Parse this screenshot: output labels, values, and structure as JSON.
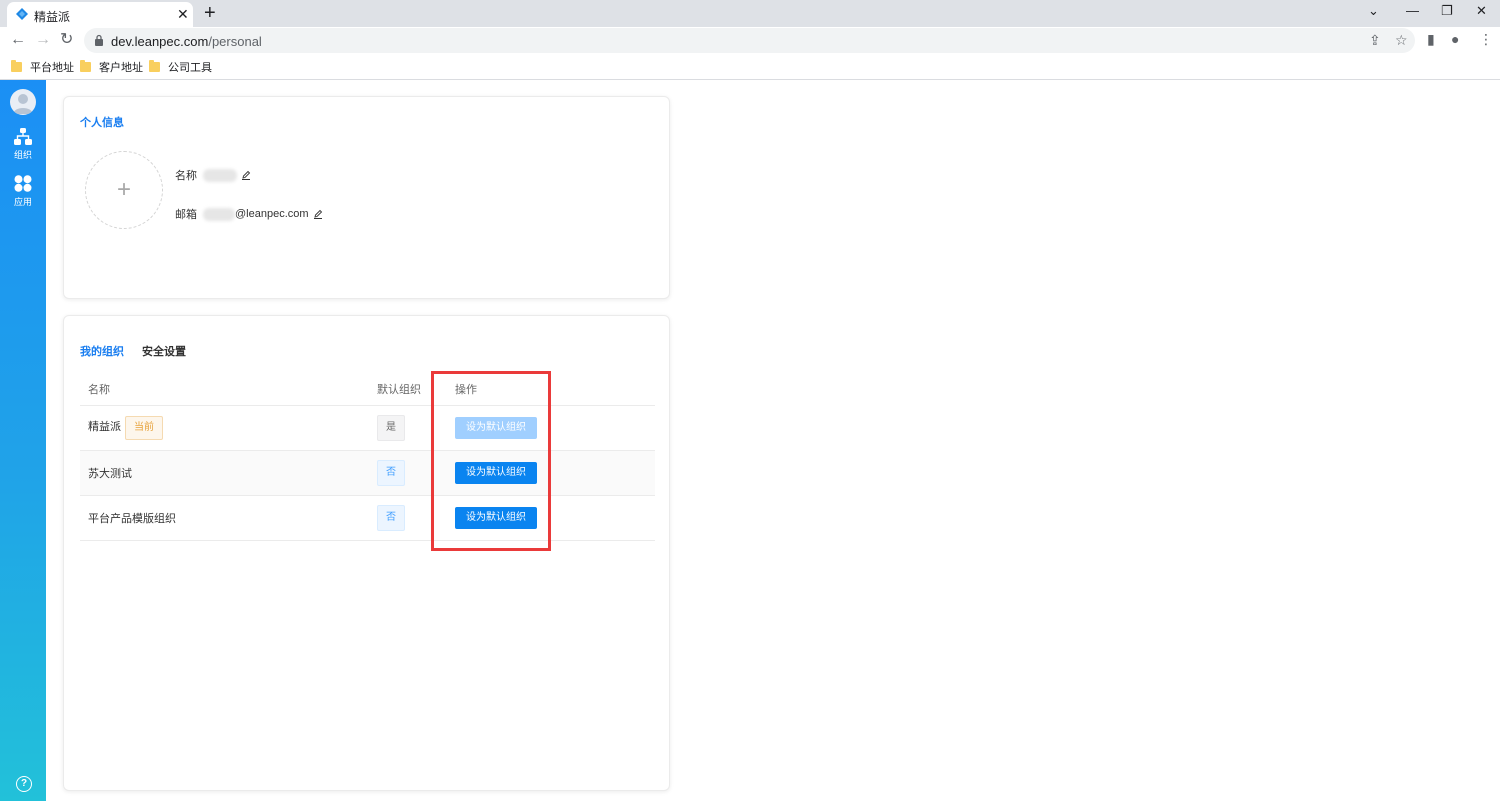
{
  "browser": {
    "tab_title": "精益派",
    "url_host": "dev.leanpec.com",
    "url_path": "/personal",
    "bookmarks": [
      "平台地址",
      "客户地址",
      "公司工具"
    ]
  },
  "sidebar": {
    "items": [
      {
        "label": "组织",
        "icon": "org-tree-icon"
      },
      {
        "label": "应用",
        "icon": "apps-icon"
      }
    ]
  },
  "profile": {
    "title": "个人信息",
    "name_label": "名称",
    "email_label": "邮箱",
    "email_suffix": "@leanpec.com"
  },
  "orgs": {
    "tabs": [
      {
        "label": "我的组织",
        "active": true
      },
      {
        "label": "安全设置",
        "active": false
      }
    ],
    "columns": [
      "名称",
      "默认组织",
      "操作"
    ],
    "rows": [
      {
        "name": "精益派",
        "badge": "当前",
        "default": "是",
        "action": "设为默认组织",
        "action_disabled": true
      },
      {
        "name": "苏大测试",
        "default": "否",
        "action": "设为默认组织",
        "action_disabled": false
      },
      {
        "name": "平台产品模版组织",
        "default": "否",
        "action": "设为默认组织",
        "action_disabled": false
      }
    ]
  },
  "colors": {
    "accent": "#1a7ef0",
    "highlight": "#ea3a3a",
    "sidebar_top": "#1b8ff5",
    "sidebar_bottom": "#22c1d9"
  }
}
